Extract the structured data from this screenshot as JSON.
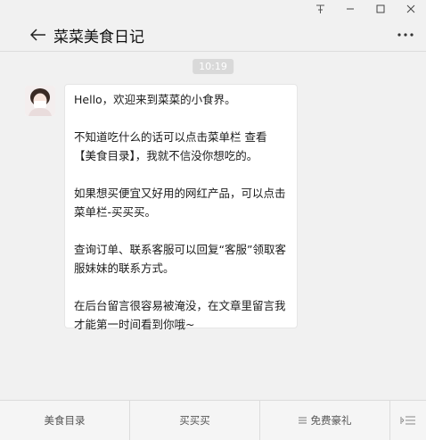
{
  "window": {
    "pin_icon": "pin-icon",
    "min_icon": "minimize-icon",
    "max_icon": "maximize-icon",
    "close_icon": "close-icon"
  },
  "header": {
    "title": "菜菜美食日记",
    "back_icon": "back-arrow-icon",
    "more_icon": "more-icon"
  },
  "chat": {
    "timestamp": "10:19",
    "message": {
      "lines": [
        "Hello，欢迎来到菜菜的小食界。",
        "不知道吃什么的话可以点击菜单栏 查看【美食目录】，我就不信没你想吃的。",
        "如果想买便宜又好用的网红产品，可以点击菜单栏-买买买。",
        "查询订单、联系客服可以回复“客服”领取客服妹妹的联系方式。",
        "在后台留言很容易被淹没，在文章里留言我才能第一时间看到你哦~"
      ]
    }
  },
  "menu": {
    "items": [
      {
        "label": "美食目录"
      },
      {
        "label": "买买买"
      },
      {
        "label": "免费豪礼",
        "icon": "list-icon"
      }
    ],
    "toggle_icon": "keyboard-toggle-icon"
  }
}
